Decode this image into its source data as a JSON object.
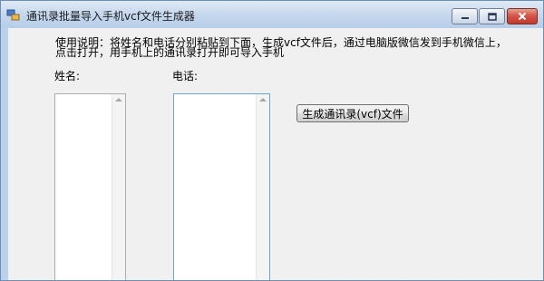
{
  "window": {
    "title": "通讯录批量导入手机vcf文件生成器",
    "icons": {
      "app": "app-icon",
      "minimize": "minimize-icon",
      "maximize": "maximize-icon",
      "close": "close-icon"
    }
  },
  "instructions": {
    "line1": "使用说明：将姓名和电话分别粘贴到下面，生成vcf文件后，通过电脑版微信发到手机微信上，",
    "line2": "点击打开，用手机上的通讯录打开即可导入手机"
  },
  "form": {
    "name_label": "姓名:",
    "phone_label": "电话:",
    "name_value": "",
    "phone_value": "",
    "generate_button_label": "生成通讯录(vcf)文件"
  },
  "colors": {
    "window_frame": "#b9d1ea",
    "client_background": "#f0f0f0",
    "close_button": "#c7483a",
    "focus_border": "#6aa3d5"
  }
}
